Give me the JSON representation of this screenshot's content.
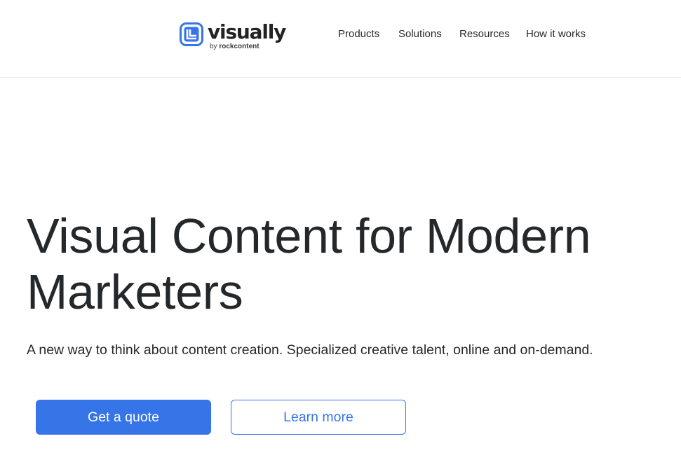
{
  "header": {
    "logo": {
      "wordmark": "visually",
      "byline_prefix": "by",
      "byline_brand": "rockcontent"
    },
    "nav": [
      {
        "label": "Products"
      },
      {
        "label": "Solutions"
      },
      {
        "label": "Resources"
      },
      {
        "label": "How it works"
      }
    ]
  },
  "hero": {
    "title_line1": "Visual Content for Modern",
    "title_line2": "Marketers",
    "subtitle": "A new way to think about content creation. Specialized creative talent, online and on-demand.",
    "primary_button": "Get a quote",
    "secondary_button": "Learn more"
  },
  "colors": {
    "brand_blue": "#3575e8",
    "text": "#25282b"
  }
}
